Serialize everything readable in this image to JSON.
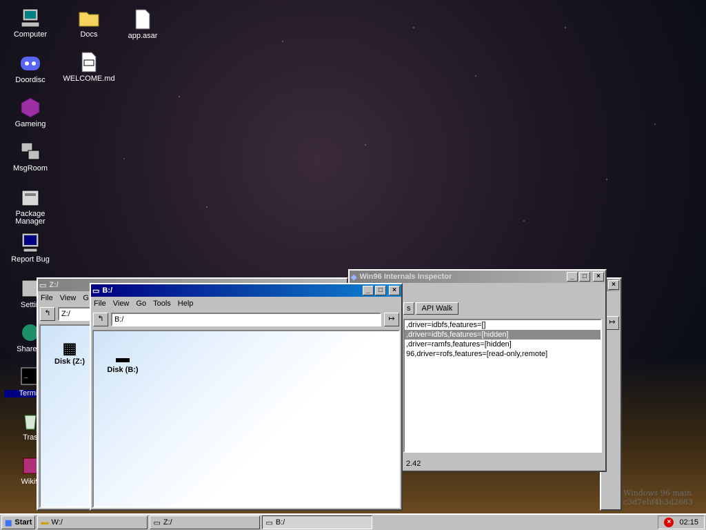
{
  "desktop": {
    "icons": [
      {
        "label": "Computer"
      },
      {
        "label": "Docs"
      },
      {
        "label": "app.asar"
      },
      {
        "label": "Doordisc"
      },
      {
        "label": "WELCOME.md"
      },
      {
        "label": "Gameing"
      },
      {
        "label": "MsgRoom"
      },
      {
        "label": "Package Manager"
      },
      {
        "label": "Report Bug"
      },
      {
        "label": "Settin"
      },
      {
        "label": "Share B"
      },
      {
        "label": "Termin"
      },
      {
        "label": "Tras"
      },
      {
        "label": "Wiki9"
      }
    ],
    "watermark_line1": "Windows 96 main",
    "watermark_line2": "c3d7ebf4b3d2683"
  },
  "inspector": {
    "title": "Win96 Internals Inspector",
    "tabs": [
      "s",
      "API Walk"
    ],
    "rows": [
      ",driver=idbfs,features=[]",
      ",driver=idbfs,features=[hidden]",
      ",driver=ramfs,features=[hidden]",
      "96,driver=rofs,features=[read-only,remote]"
    ],
    "status": "2.42"
  },
  "zwin": {
    "title": "Z:/",
    "menu": [
      "File",
      "View",
      "G"
    ],
    "path": "Z:/",
    "disk": "Disk (Z:)"
  },
  "bwin": {
    "title": "B:/",
    "menu": [
      "File",
      "View",
      "Go",
      "Tools",
      "Help"
    ],
    "path": "B:/",
    "disk": "Disk (B:)"
  },
  "taskbar": {
    "start": "Start",
    "items": [
      "W:/",
      "Z:/",
      "B:/"
    ],
    "clock": "02:15"
  }
}
